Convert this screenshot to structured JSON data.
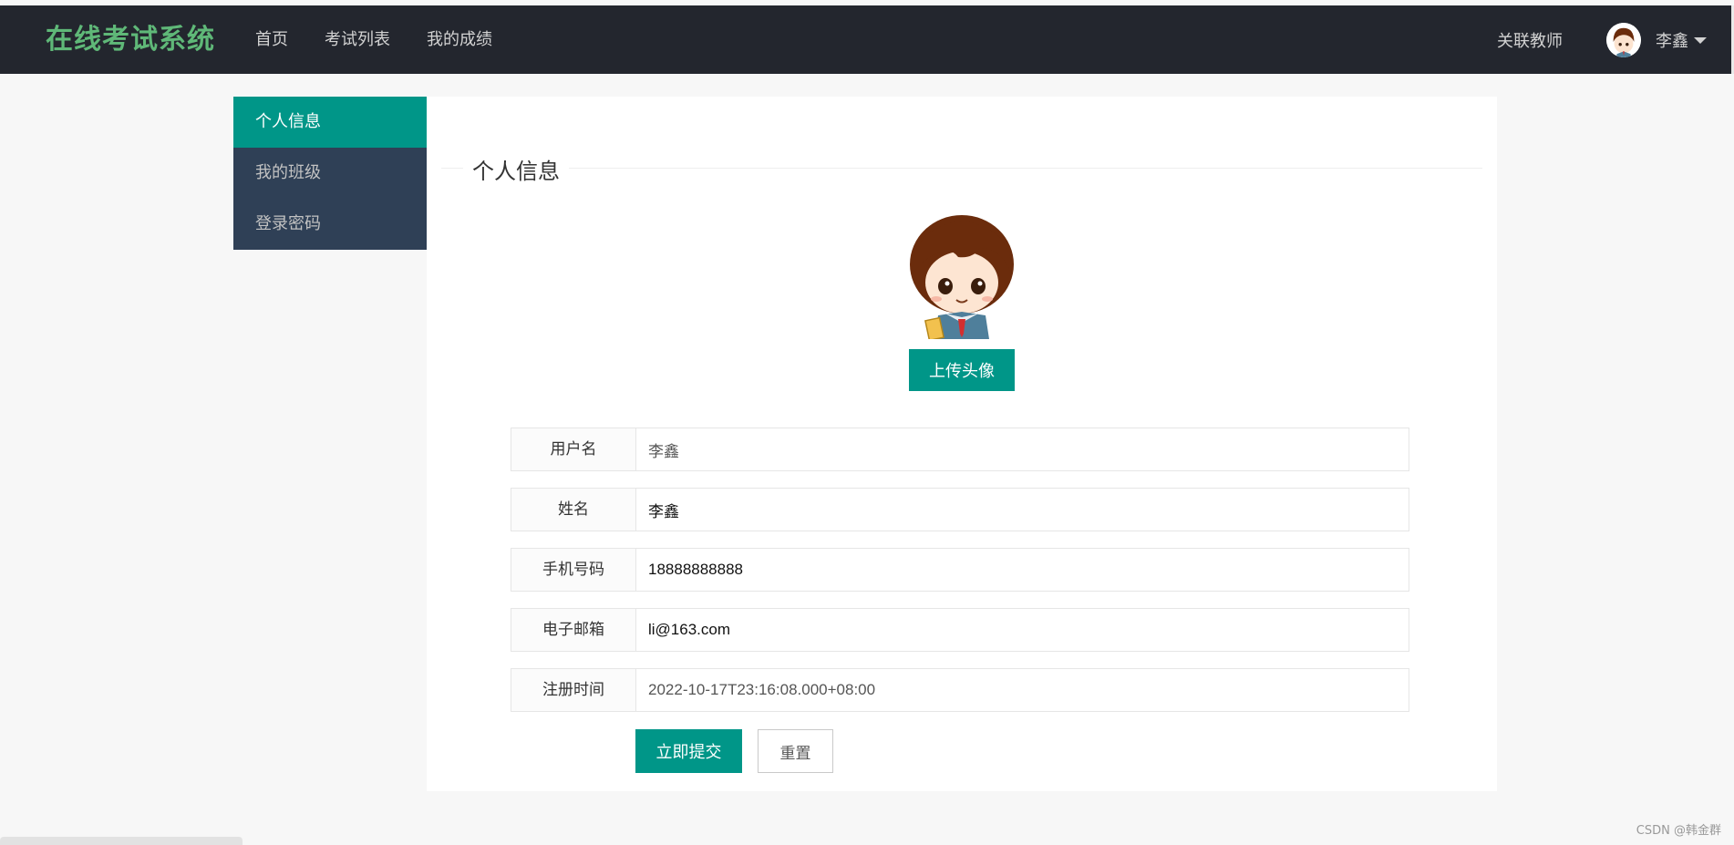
{
  "header": {
    "logo": "在线考试系统",
    "nav": [
      "首页",
      "考试列表",
      "我的成绩"
    ],
    "teacher_link": "关联教师",
    "user_name": "李鑫",
    "logo_color": "#5fb878",
    "bg_color": "#23262e"
  },
  "sidebar": {
    "items": [
      {
        "label": "个人信息",
        "active": true
      },
      {
        "label": "我的班级",
        "active": false
      },
      {
        "label": "登录密码",
        "active": false
      }
    ]
  },
  "main": {
    "section_title": "个人信息",
    "upload_label": "上传头像",
    "fields": [
      {
        "label": "用户名",
        "value": "李鑫",
        "readonly": true
      },
      {
        "label": "姓名",
        "value": "李鑫",
        "readonly": false
      },
      {
        "label": "手机号码",
        "value": "18888888888",
        "readonly": false
      },
      {
        "label": "电子邮箱",
        "value": "li@163.com",
        "readonly": false
      },
      {
        "label": "注册时间",
        "value": "2022-10-17T23:16:08.000+08:00",
        "readonly": true
      }
    ],
    "submit_label": "立即提交",
    "reset_label": "重置",
    "accent_color": "#009688"
  },
  "watermark": "CSDN @韩金群"
}
